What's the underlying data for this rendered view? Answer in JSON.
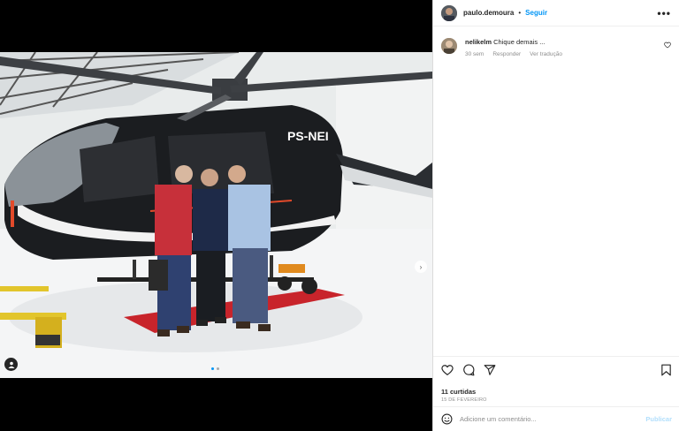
{
  "post": {
    "username": "paulo.demoura",
    "follow_label": "Seguir",
    "more_label": "•••"
  },
  "comments": [
    {
      "username": "nelikelm",
      "text": "Chique demais ...",
      "time": "30 sem",
      "reply_label": "Responder",
      "translate_label": "Ver tradução"
    }
  ],
  "photo": {
    "aircraft_registration": "PS-NEI",
    "carousel_count": 2,
    "carousel_active": 1
  },
  "actions": {
    "likes": "11 curtidas",
    "date": "15 DE FEVEREIRO"
  },
  "add_comment": {
    "placeholder": "Adicione um comentário...",
    "publish_label": "Publicar"
  },
  "icons": [
    "heart-icon",
    "comment-icon",
    "share-icon",
    "bookmark-icon",
    "emoji-icon",
    "more-icon",
    "chevron-right-icon",
    "user-tag-icon"
  ]
}
